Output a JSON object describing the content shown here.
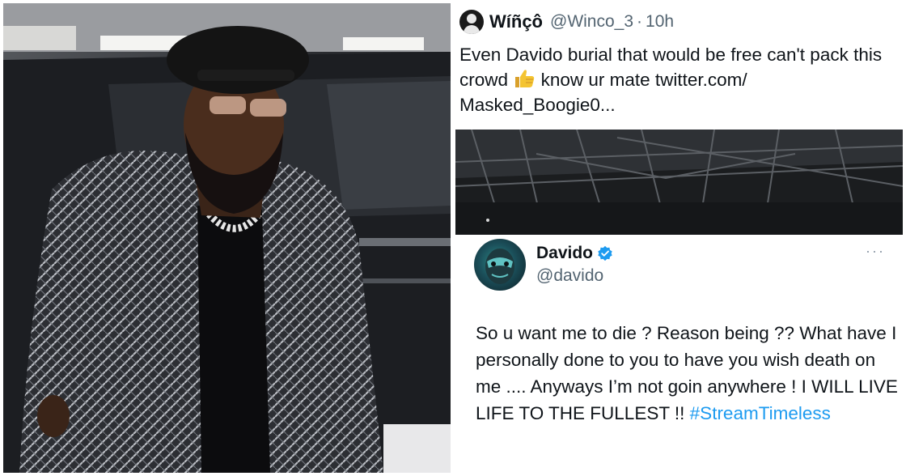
{
  "photo": {
    "alt_subject": "man-in-herringbone-coat"
  },
  "tweet_top": {
    "display_name": "Wíñçô",
    "handle": "@Winco_3",
    "separator": "·",
    "time": "10h",
    "text_part1": "Even Davido burial that would be free can't pack this crowd",
    "emoji": "thumbs-up-icon",
    "text_part2": " know ur mate twitter.com/ Masked_Boogie0..."
  },
  "tweet_bottom": {
    "display_name": "Davido",
    "handle": "@davido",
    "more": "···",
    "text": "So u want me to die ? Reason being ?? What have I personally done to you to have you wish death on me .... Anyways I’m not goin anywhere ! I WILL LIVE LIFE TO THE FULLEST !! ",
    "hashtag": "#StreamTimeless"
  },
  "colors": {
    "text": "#0f1419",
    "muted": "#536471",
    "link": "#1d9bf0",
    "verified": "#1d9bf0"
  }
}
